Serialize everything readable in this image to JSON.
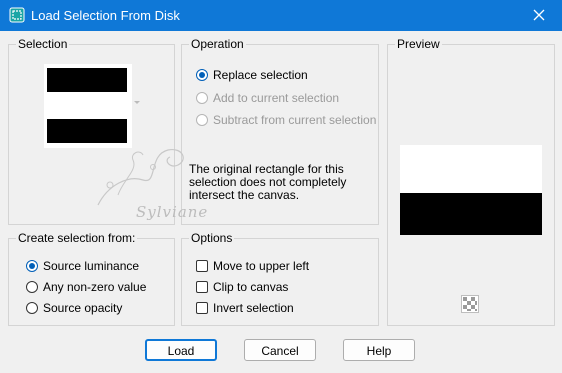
{
  "window": {
    "title": "Load Selection From Disk"
  },
  "selection_group": {
    "label": "Selection"
  },
  "operation_group": {
    "label": "Operation",
    "options": [
      {
        "label": "Replace selection",
        "checked": true,
        "enabled": true
      },
      {
        "label": "Add to current selection",
        "checked": false,
        "enabled": false
      },
      {
        "label": "Subtract from current selection",
        "checked": false,
        "enabled": false
      }
    ],
    "message": "The original rectangle for this selection does not completely intersect the canvas."
  },
  "preview_group": {
    "label": "Preview"
  },
  "create_group": {
    "label": "Create selection from:",
    "options": [
      {
        "label": "Source luminance",
        "checked": true
      },
      {
        "label": "Any non-zero value",
        "checked": false
      },
      {
        "label": "Source opacity",
        "checked": false
      }
    ]
  },
  "options_group": {
    "label": "Options",
    "checkboxes": [
      {
        "label": "Move to upper left",
        "checked": false
      },
      {
        "label": "Clip to canvas",
        "checked": false
      },
      {
        "label": "Invert selection",
        "checked": false
      }
    ]
  },
  "buttons": {
    "load": "Load",
    "cancel": "Cancel",
    "help": "Help"
  },
  "watermark": {
    "text": "Sylviane"
  },
  "colors": {
    "titlebar": "#0f78d7",
    "accent": "#005fb8",
    "background": "#f0f0f0"
  }
}
